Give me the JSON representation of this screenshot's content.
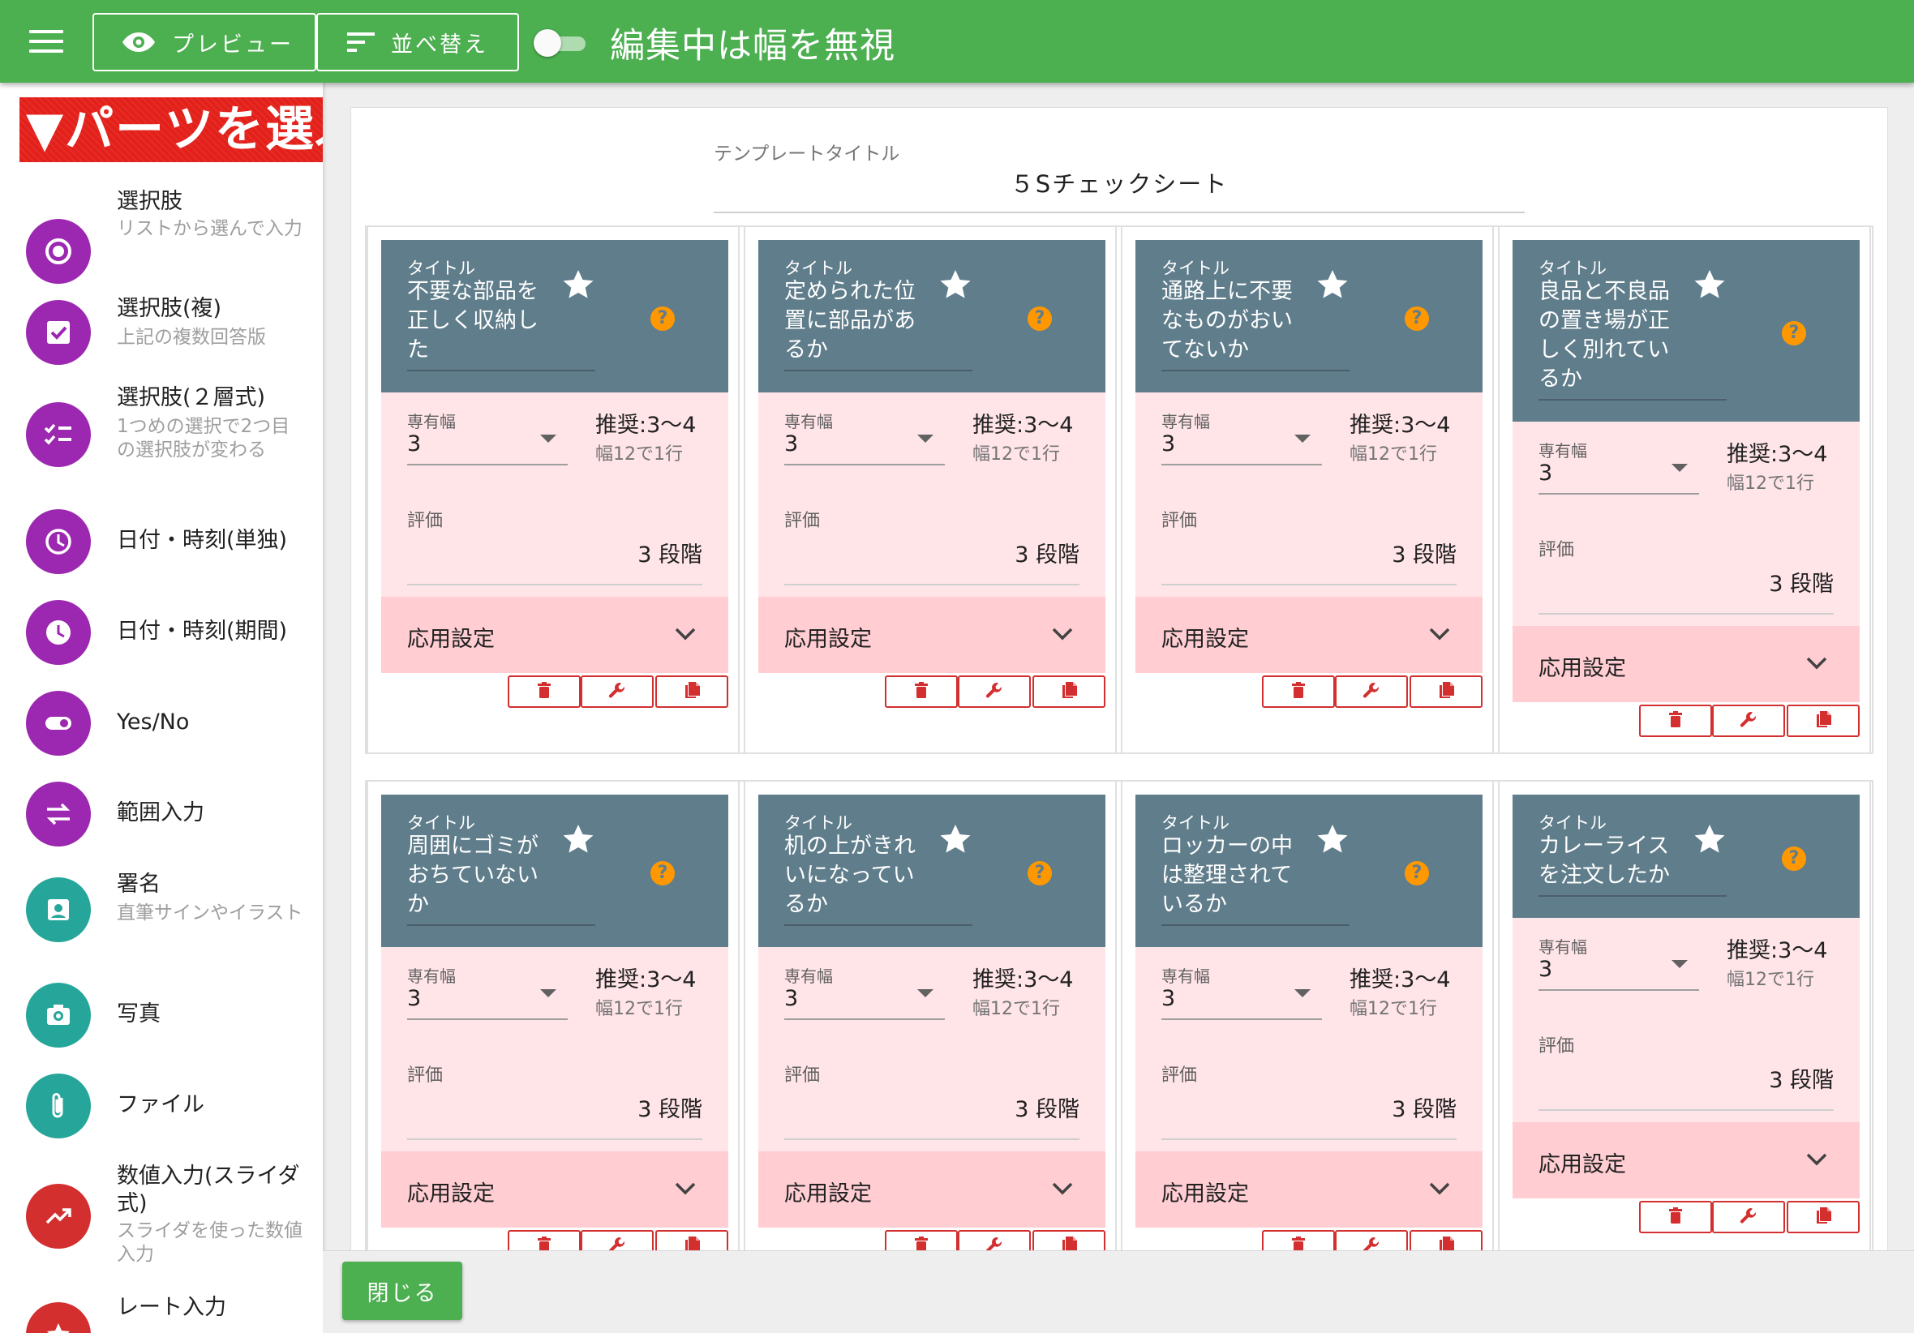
{
  "topbar": {
    "preview_label": "プレビュー",
    "sort_label": "並べ替え",
    "ignore_width_toggle": false,
    "ignore_width_label": "編集中は幅を無視",
    "icons": [
      "menu-icon",
      "eye-icon",
      "sort-icon"
    ]
  },
  "sidebar": {
    "banner": "▼パーツを選ぶ",
    "items": [
      {
        "title": "選択肢",
        "sub": "リストから選んで入力",
        "icon": "radio-icon",
        "color": "#9c27b0"
      },
      {
        "title": "選択肢(複)",
        "sub": "上記の複数回答版",
        "icon": "checkbox-icon",
        "color": "#9c27b0"
      },
      {
        "title": "選択肢(２層式)",
        "sub": "1つめの選択で2つ目の選択肢が変わる",
        "icon": "checklist-icon",
        "color": "#9c27b0"
      },
      {
        "title": "日付・時刻(単独)",
        "sub": "",
        "icon": "clock-outline-icon",
        "color": "#9c27b0"
      },
      {
        "title": "日付・時刻(期間)",
        "sub": "",
        "icon": "clock-filled-icon",
        "color": "#9c27b0"
      },
      {
        "title": "Yes/No",
        "sub": "",
        "icon": "toggle-icon",
        "color": "#9c27b0"
      },
      {
        "title": "範囲入力",
        "sub": "",
        "icon": "swap-arrows-icon",
        "color": "#9c27b0"
      },
      {
        "title": "署名",
        "sub": "直筆サインやイラスト",
        "icon": "signature-icon",
        "color": "#26a69a"
      },
      {
        "title": "写真",
        "sub": "",
        "icon": "camera-icon",
        "color": "#26a69a"
      },
      {
        "title": "ファイル",
        "sub": "",
        "icon": "paperclip-icon",
        "color": "#26a69a"
      },
      {
        "title": "数値入力(スライダ式)",
        "sub": "スライダを使った数値入力",
        "icon": "trending-icon",
        "color": "#d32f2f"
      },
      {
        "title": "レート入力",
        "sub": "",
        "icon": "star-icon",
        "color": "#d32f2f"
      }
    ]
  },
  "template": {
    "title_label": "テンプレートタイトル",
    "title_value": "５Sチェックシート"
  },
  "card_labels": {
    "title": "タイトル",
    "width": "専有幅",
    "recommend": "推奨:3〜4",
    "recommend_sub": "幅12で1行",
    "rating": "評価",
    "advanced": "応用設定",
    "help": "?"
  },
  "cards": [
    {
      "title": "不要な部品を\n正しく収納し\nた",
      "width": "3",
      "rating_value": "3 段階"
    },
    {
      "title": "定められた位\n置に部品があ\nるか",
      "width": "3",
      "rating_value": "3 段階"
    },
    {
      "title": "通路上に不要\nなものがおい\nてないか",
      "width": "3",
      "rating_value": "3 段階"
    },
    {
      "title": "良品と不良品\nの置き場が正\nしく別れてい\nるか",
      "width": "3",
      "rating_value": "3 段階"
    },
    {
      "title": "周囲にゴミが\nおちていない\nか",
      "width": "3",
      "rating_value": "3 段階"
    },
    {
      "title": "机の上がきれ\nいになってい\nるか",
      "width": "3",
      "rating_value": "3 段階"
    },
    {
      "title": "ロッカーの中\nは整理されて\nいるか",
      "width": "3",
      "rating_value": "3 段階"
    },
    {
      "title": "カレーライス\nを注文したか",
      "width": "3",
      "rating_value": "3 段階"
    }
  ],
  "bottombar": {
    "close_label": "閉じる"
  }
}
